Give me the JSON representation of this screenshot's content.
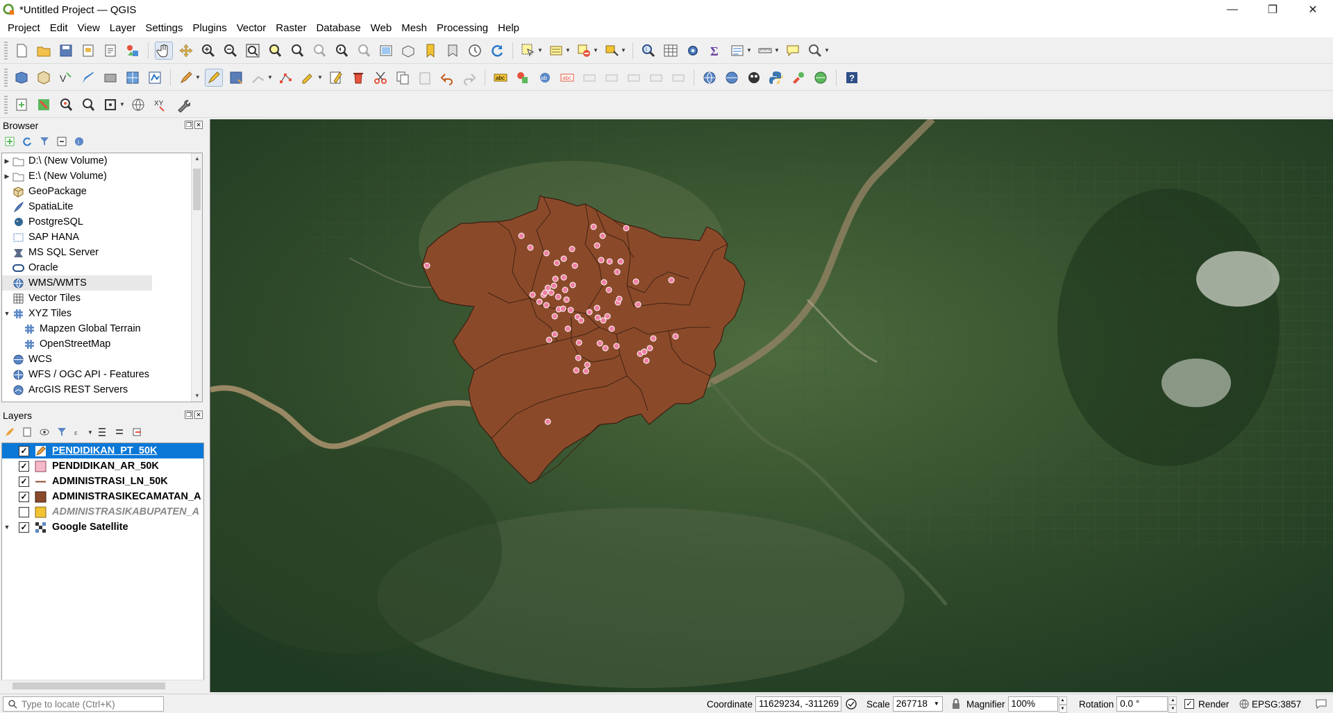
{
  "window": {
    "title": "*Untitled Project — QGIS",
    "minimize": "—",
    "restore": "❐",
    "close": "✕"
  },
  "menu": [
    "Project",
    "Edit",
    "View",
    "Layer",
    "Settings",
    "Plugins",
    "Vector",
    "Raster",
    "Database",
    "Web",
    "Mesh",
    "Processing",
    "Help"
  ],
  "browser": {
    "title": "Browser",
    "items": [
      {
        "label": "D:\\ (New Volume)",
        "icon": "folder-icon",
        "expand": "▶"
      },
      {
        "label": "E:\\ (New Volume)",
        "icon": "folder-icon",
        "expand": "▶"
      },
      {
        "label": "GeoPackage",
        "icon": "geopackage-icon",
        "expand": ""
      },
      {
        "label": "SpatiaLite",
        "icon": "spatialite-icon",
        "expand": ""
      },
      {
        "label": "PostgreSQL",
        "icon": "postgresql-icon",
        "expand": ""
      },
      {
        "label": "SAP HANA",
        "icon": "sap-hana-icon",
        "expand": ""
      },
      {
        "label": "MS SQL Server",
        "icon": "mssql-icon",
        "expand": ""
      },
      {
        "label": "Oracle",
        "icon": "oracle-icon",
        "expand": ""
      },
      {
        "label": "WMS/WMTS",
        "icon": "wms-icon",
        "expand": ""
      },
      {
        "label": "Vector Tiles",
        "icon": "vector-tiles-icon",
        "expand": ""
      },
      {
        "label": "XYZ Tiles",
        "icon": "xyz-tiles-icon",
        "expand": "▼"
      },
      {
        "label": "Mapzen Global Terrain",
        "icon": "tile-grid-icon",
        "expand": "",
        "child": true
      },
      {
        "label": "OpenStreetMap",
        "icon": "tile-grid-icon",
        "expand": "",
        "child": true
      },
      {
        "label": "WCS",
        "icon": "wcs-icon",
        "expand": ""
      },
      {
        "label": "WFS / OGC API - Features",
        "icon": "wfs-icon",
        "expand": ""
      },
      {
        "label": "ArcGIS REST Servers",
        "icon": "arcgis-icon",
        "expand": ""
      }
    ]
  },
  "layers": {
    "title": "Layers",
    "items": [
      {
        "label": "PENDIDIKAN_PT_50K",
        "checked": "✓",
        "symbol": "pencil-edit-icon",
        "selected": true
      },
      {
        "label": "PENDIDIKAN_AR_50K",
        "checked": "✓",
        "symbol": "pink-fill"
      },
      {
        "label": "ADMINISTRASI_LN_50K",
        "checked": "✓",
        "symbol": "line"
      },
      {
        "label": "ADMINISTRASIKECAMATAN_A",
        "checked": "✓",
        "symbol": "brown-fill"
      },
      {
        "label": "ADMINISTRASIKABUPATEN_A",
        "checked": "",
        "symbol": "yellow-fill",
        "disabled": true
      },
      {
        "label": "Google Satellite",
        "checked": "✓",
        "symbol": "raster-icon",
        "expand": "▼"
      }
    ]
  },
  "status": {
    "locator_placeholder": "Type to locate (Ctrl+K)",
    "coordinate_label": "Coordinate",
    "coordinate_value": "11629234, -311269",
    "scale_label": "Scale",
    "scale_value": "267718",
    "magnifier_label": "Magnifier",
    "magnifier_value": "100%",
    "rotation_label": "Rotation",
    "rotation_value": "0.0 °",
    "render_label": "Render",
    "render_checked": "✓",
    "crs": "EPSG:3857"
  },
  "colors": {
    "polygon_fill": "#8a4a2a",
    "point_fill": "#ef7fa0",
    "selection": "#0a78d7",
    "satellite_base": "#2f4a2a"
  }
}
